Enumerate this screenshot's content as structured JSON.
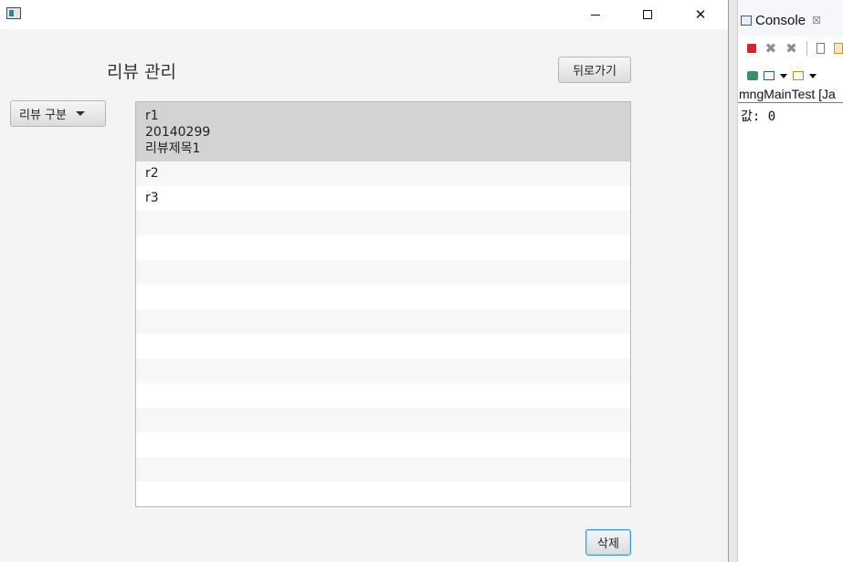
{
  "window": {
    "controls": {
      "minimize": "minimize",
      "maximize": "maximize",
      "close": "✕"
    }
  },
  "header": {
    "title": "리뷰 관리",
    "back_label": "뒤로가기"
  },
  "filter": {
    "category_label": "리뷰 구분"
  },
  "review_list": {
    "selected_item": {
      "id": "r1",
      "date": "20140299",
      "title": "리뷰제목1"
    },
    "items": [
      "r2",
      "r3"
    ]
  },
  "footer": {
    "delete_label": "삭제"
  },
  "eclipse": {
    "tab_label": "Console",
    "tab_close": "☒",
    "launch_label": "mngMainTest [Ja",
    "output_line": "값: 0"
  }
}
